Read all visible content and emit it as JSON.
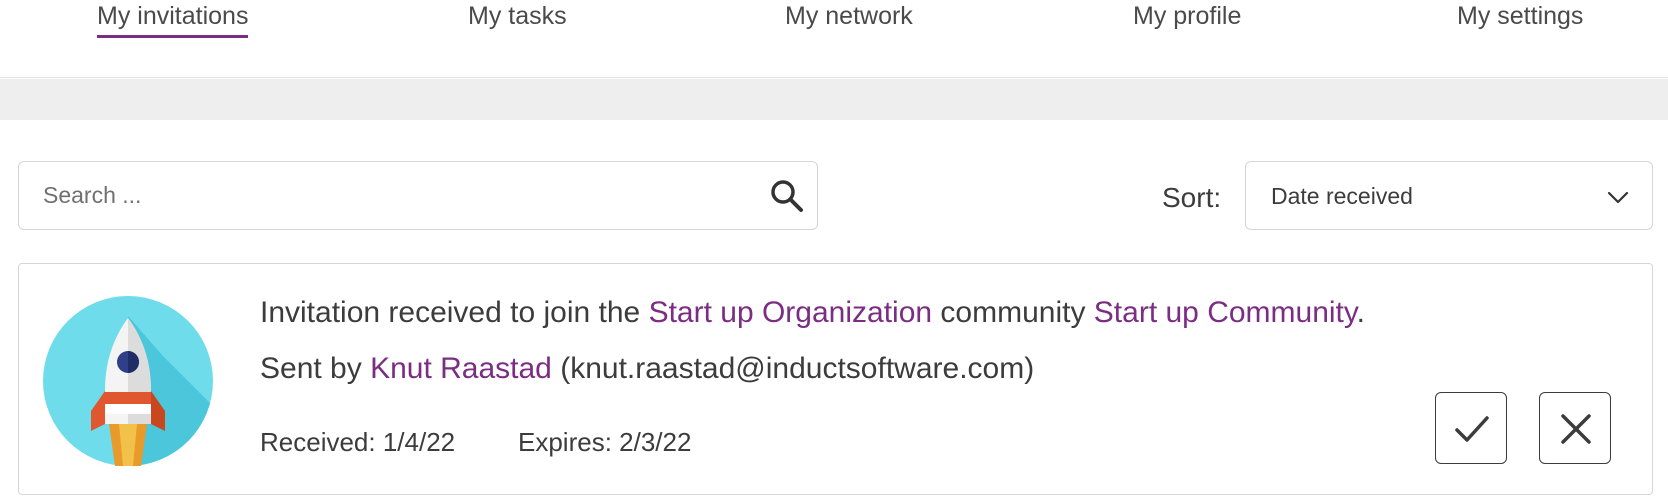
{
  "nav": {
    "tabs": [
      {
        "label": "My invitations",
        "active": true
      },
      {
        "label": "My tasks",
        "active": false
      },
      {
        "label": "My network",
        "active": false
      },
      {
        "label": "My profile",
        "active": false
      },
      {
        "label": "My settings",
        "active": false
      }
    ]
  },
  "search": {
    "placeholder": "Search ...",
    "value": ""
  },
  "sort": {
    "label": "Sort:",
    "selected": "Date received"
  },
  "invitation": {
    "text_prefix": "Invitation received to join the ",
    "organization": "Start up Organization",
    "text_middle": " community ",
    "community": "Start up Community",
    "text_suffix": ".",
    "sent_by_prefix": "Sent by ",
    "sender_name": "Knut Raastad",
    "sender_email": " (knut.raastad@inductsoftware.com)",
    "received": "Received: 1/4/22",
    "expires": "Expires: 2/3/22"
  },
  "colors": {
    "accent": "#7b2c83",
    "avatar_bg": "#6fdcec"
  },
  "icons": {
    "search": "search-icon",
    "chevron": "chevron-down-icon",
    "accept": "check-icon",
    "decline": "close-icon",
    "avatar": "rocket-icon"
  }
}
